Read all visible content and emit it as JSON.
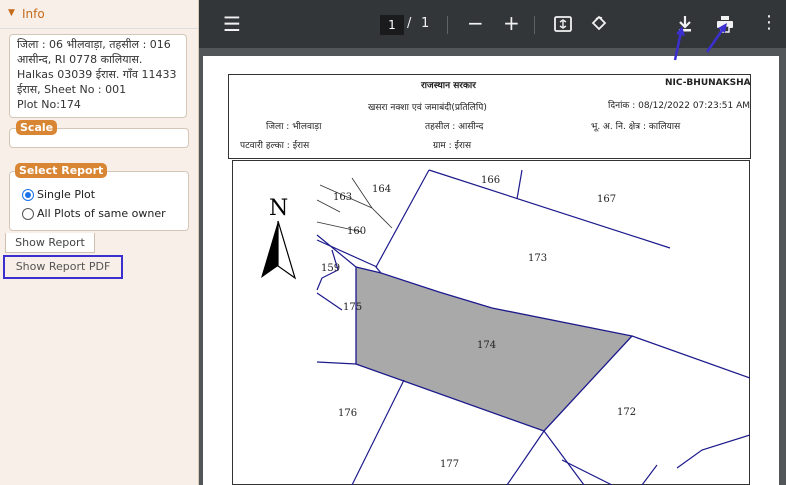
{
  "sidebar": {
    "info_header": "Info",
    "info_lines": [
      "जिला : 06 भीलवाड़ा, तहसील : 016",
      "आसीन्द, RI   0778 कालियास.",
      "Halkas   03039 ईरास. गाँव   11433",
      "ईरास, Sheet No : 001",
      "Plot No:174"
    ],
    "scale_label": "Scale",
    "select_report_label": "Select Report",
    "options": [
      {
        "label": "Single Plot",
        "selected": true
      },
      {
        "label": "All Plots of same owner",
        "selected": false
      }
    ],
    "show_report": "Show Report",
    "show_report_pdf": "Show Report PDF"
  },
  "viewer": {
    "page_current": "1",
    "page_sep": "/",
    "page_total": "1"
  },
  "document": {
    "title": "राजस्थान सरकार",
    "brand": "NIC-BHUNAKSHA",
    "subtitle": "खसरा नक्शा एवं जमाबंदी(प्रतिलिपि)",
    "date": "दिनांक : 08/12/2022 07:23:51 AM",
    "district": "जिला : भीलवाड़ा",
    "tehsil": "तहसील :  आसीन्द",
    "land_records": "भू. अ. नि.  क्षेत्र : कालियास",
    "patwari": "पटवारी हल्का : ईरास",
    "village": "ग्राम :  ईरास",
    "north": "N",
    "plots": [
      "163",
      "164",
      "166",
      "167",
      "160",
      "173",
      "159",
      "175",
      "174",
      "176",
      "172",
      "177"
    ]
  },
  "colors": {
    "highlight": "#3b2fd0",
    "plot_fill": "#a9a9a9",
    "boundary": "#1d1a8c",
    "accent": "#d88634"
  }
}
